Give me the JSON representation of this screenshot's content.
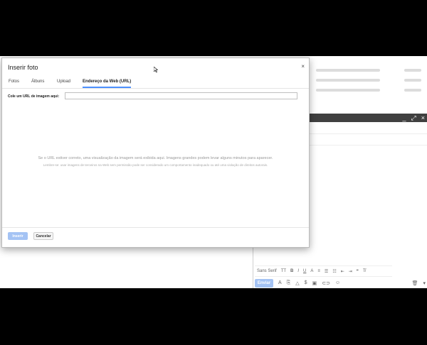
{
  "dialog": {
    "title": "Inserir foto",
    "close_icon": "×",
    "tabs": [
      {
        "label": "Fotos"
      },
      {
        "label": "Álbuns"
      },
      {
        "label": "Upload"
      },
      {
        "label": "Endereço da Web (URL)",
        "active": true
      }
    ],
    "url_label": "Cole um URL de imagem aqui:",
    "url_value": "",
    "hint_preview": "Se o URL estiver correto, uma visualização da imagem será exibida aqui. Imagens grandes podem levar alguns minutos para aparecer.",
    "hint_copyright": "Lembre-se: usar imagens de terceiros na Web sem permissão pode ser considerado um comportamento inadequado ou até uma violação de direitos autorais.",
    "insert_label": "Inserir",
    "cancel_label": "Cancelar"
  },
  "compose": {
    "header_icons": [
      "_",
      "⤢",
      "×"
    ],
    "font_label": "Sans Serif",
    "send_label": "Enviar"
  },
  "colors": {
    "accent": "#4d90fe",
    "primary_button": "#a4c3f4",
    "compose_header": "#404040"
  }
}
